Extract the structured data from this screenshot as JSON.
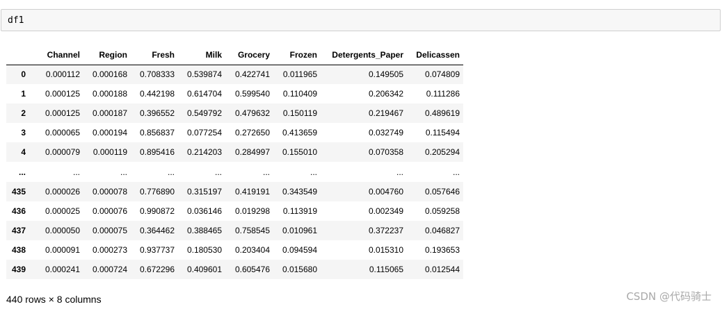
{
  "input_cell": {
    "code": "df1"
  },
  "table": {
    "columns": [
      "Channel",
      "Region",
      "Fresh",
      "Milk",
      "Grocery",
      "Frozen",
      "Detergents_Paper",
      "Delicassen"
    ],
    "rows": [
      {
        "index": "0",
        "values": [
          "0.000112",
          "0.000168",
          "0.708333",
          "0.539874",
          "0.422741",
          "0.011965",
          "0.149505",
          "0.074809"
        ]
      },
      {
        "index": "1",
        "values": [
          "0.000125",
          "0.000188",
          "0.442198",
          "0.614704",
          "0.599540",
          "0.110409",
          "0.206342",
          "0.111286"
        ]
      },
      {
        "index": "2",
        "values": [
          "0.000125",
          "0.000187",
          "0.396552",
          "0.549792",
          "0.479632",
          "0.150119",
          "0.219467",
          "0.489619"
        ]
      },
      {
        "index": "3",
        "values": [
          "0.000065",
          "0.000194",
          "0.856837",
          "0.077254",
          "0.272650",
          "0.413659",
          "0.032749",
          "0.115494"
        ]
      },
      {
        "index": "4",
        "values": [
          "0.000079",
          "0.000119",
          "0.895416",
          "0.214203",
          "0.284997",
          "0.155010",
          "0.070358",
          "0.205294"
        ]
      },
      {
        "index": "...",
        "values": [
          "...",
          "...",
          "...",
          "...",
          "...",
          "...",
          "...",
          "..."
        ]
      },
      {
        "index": "435",
        "values": [
          "0.000026",
          "0.000078",
          "0.776890",
          "0.315197",
          "0.419191",
          "0.343549",
          "0.004760",
          "0.057646"
        ]
      },
      {
        "index": "436",
        "values": [
          "0.000025",
          "0.000076",
          "0.990872",
          "0.036146",
          "0.019298",
          "0.113919",
          "0.002349",
          "0.059258"
        ]
      },
      {
        "index": "437",
        "values": [
          "0.000050",
          "0.000075",
          "0.364462",
          "0.388465",
          "0.758545",
          "0.010961",
          "0.372237",
          "0.046827"
        ]
      },
      {
        "index": "438",
        "values": [
          "0.000091",
          "0.000273",
          "0.937737",
          "0.180530",
          "0.203404",
          "0.094594",
          "0.015310",
          "0.193653"
        ]
      },
      {
        "index": "439",
        "values": [
          "0.000241",
          "0.000724",
          "0.672296",
          "0.409601",
          "0.605476",
          "0.015680",
          "0.115065",
          "0.012544"
        ]
      }
    ]
  },
  "shape_text": "440 rows × 8 columns",
  "watermark": "CSDN @代码骑士",
  "colors": {
    "input_bg": "#f7f7f7",
    "input_border": "#cfcfcf",
    "row_stripe": "#f5f5f5",
    "watermark": "#a9a9a9"
  }
}
